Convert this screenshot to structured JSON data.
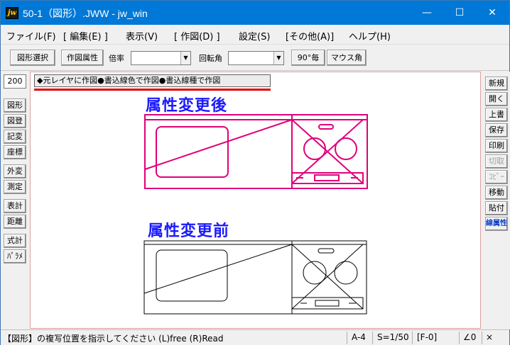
{
  "window": {
    "title": "50-1（図形）.JWW - jw_win",
    "icon_text": "jw",
    "controls": {
      "minimize": "—",
      "maximize": "☐",
      "close": "✕"
    }
  },
  "menu": [
    "ファイル(F)",
    "[ 編集(E) ]",
    "表示(V)",
    "[ 作図(D) ]",
    "設定(S)",
    "[その他(A)]",
    "ヘルプ(H)"
  ],
  "toolbar": {
    "select_figure": "図形選択",
    "draw_attribute": "作図属性",
    "scale_label": "倍率",
    "scale_value": "",
    "rotation_label": "回転角",
    "rotation_value": "",
    "ninety_button": "90°毎",
    "mouse_angle": "マウス角"
  },
  "left_toolbar": {
    "scale_field": "200",
    "items": [
      "図形",
      "図登",
      "記変",
      "座標",
      "外変",
      "測定",
      "表計",
      "距離",
      "式計",
      "ﾊﾟﾗﾒ"
    ]
  },
  "right_toolbar": {
    "items": [
      "新規",
      "開く",
      "上書",
      "保存",
      "印刷",
      "切取",
      "ｺﾋﾟｰ",
      "移動",
      "貼付",
      "線属性"
    ],
    "disabled": [
      "切取",
      "ｺﾋﾟｰ"
    ],
    "active": "線属性"
  },
  "canvas": {
    "banner": "◆元レイヤに作図●書込線色で作図●書込線種で作図",
    "label_after": "属性変更後",
    "label_before": "属性変更前",
    "colors": {
      "after": "#e0007a",
      "before": "#000000",
      "heading": "#1a1aff"
    }
  },
  "status": {
    "message": "【図形】の複写位置を指示してください (L)free (R)Read",
    "paper": "A-4",
    "scale": "S=1/50",
    "layer": "[F-0]",
    "angle": "∠0",
    "x_button": "×"
  }
}
